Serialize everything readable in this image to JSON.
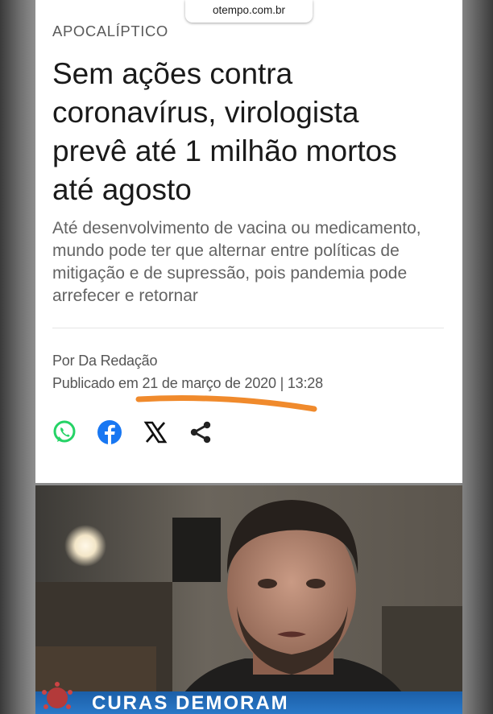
{
  "browser": {
    "url": "otempo.com.br"
  },
  "article": {
    "kicker": "APOCALÍPTICO",
    "headline": "Sem ações contra coronavírus, virologista prevê até 1 milhão mortos até agosto",
    "subhead": "Até desenvolvimento de vacina ou medicamento, mundo pode ter que alternar entre políticas de mitigação e de supressão, pois pandemia pode arrefecer e retornar",
    "byline": "Por Da Redação",
    "published": "Publicado em 21 de março de 2020 | 13:28"
  },
  "share": {
    "icons": [
      "whatsapp-icon",
      "facebook-icon",
      "x-icon",
      "share-icon"
    ],
    "colors": {
      "whatsapp": "#25D366",
      "facebook": "#1877F2",
      "x": "#111111",
      "share": "#222222"
    }
  },
  "video": {
    "caption": "CURAS DEMORAM"
  },
  "annotation": {
    "underline_color": "#F08A2C"
  }
}
